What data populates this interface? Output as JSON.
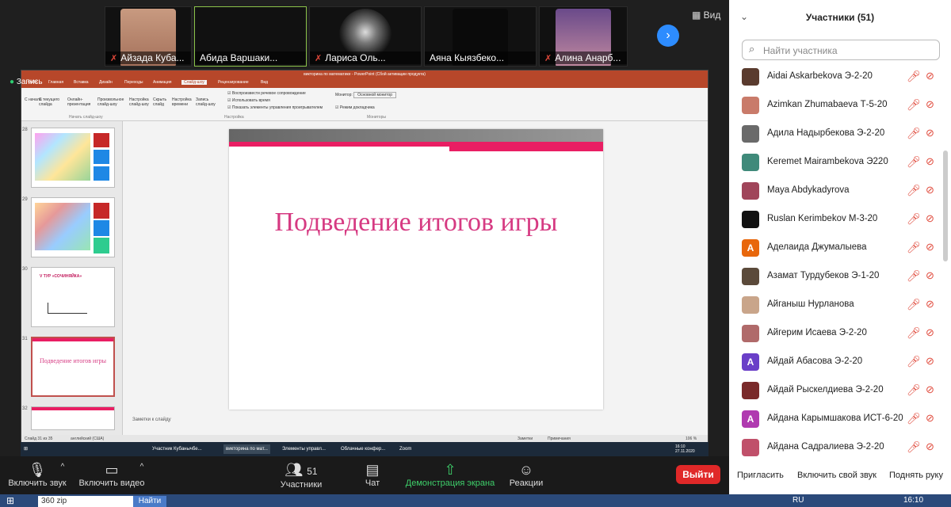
{
  "videos": [
    {
      "name": "Айзада Куба...",
      "muted": true
    },
    {
      "name": "Абида Варшаки...",
      "muted": false
    },
    {
      "name": "Лариса Оль...",
      "muted": true
    },
    {
      "name": "Аяна Кыязбеко...",
      "muted": false
    },
    {
      "name": "Алина Анарб...",
      "muted": true
    }
  ],
  "view_label": "Вид",
  "recording_label": "Запись",
  "ppt": {
    "title": "викторина по математике - PowerPoint (Сбой активации продукта)",
    "tabs": [
      "Файл",
      "Главная",
      "Вставка",
      "Дизайн",
      "Переходы",
      "Анимация",
      "Слайд-шоу",
      "Рецензирование",
      "Вид"
    ],
    "ribbon_groups": [
      "Начать слайд-шоу",
      "Настройка",
      "Мониторы"
    ],
    "ribbon_items": [
      "С начала",
      "С текущего слайда",
      "Онлайн-презентация",
      "Произвольное слайд-шоу",
      "Настройка слайд-шоу",
      "Скрыть слайд",
      "Настройка времени",
      "Запись слайд-шоу"
    ],
    "checks": [
      "Воспроизвести речевое сопровождение",
      "Использовать время",
      "Показать элементы управления проигрывателем"
    ],
    "monitor_label": "Монитор:",
    "monitor_value": "Основной монитор",
    "presenter_view": "Режим докладчика",
    "slide_numbers": [
      "28",
      "29",
      "30",
      "31",
      "32"
    ],
    "slide30_heading": "V ТУР «СОЧИНЯЙКА»",
    "slide31_text": "Подведение итогов игры",
    "main_slide_text": "Подведение итогов игры",
    "notes_placeholder": "Заметки к слайду",
    "status_left": "Слайд 31 из 35",
    "status_lang": "английский (США)",
    "status_notes": "Заметки",
    "status_comments": "Примечания",
    "zoom": "106 %",
    "clock_time": "16:10",
    "clock_date": "27.11.2020"
  },
  "share_taskbar": [
    "Участник Кубанычбе...",
    "викторина по мат...",
    "Элементы управл...",
    "Облачные конфер...",
    "Zoom"
  ],
  "controls": {
    "audio": "Включить звук",
    "video": "Включить видео",
    "participants": "Участники",
    "participants_count": "51",
    "chat": "Чат",
    "share": "Демонстрация экрана",
    "reactions": "Реакции",
    "end": "Выйти"
  },
  "os_taskbar": {
    "search_text": "360 zip",
    "search_button": "Найти",
    "lang": "RU",
    "time": "16:10"
  },
  "panel": {
    "title": "Участники (51)",
    "search_placeholder": "Найти участника",
    "participants": [
      {
        "name": "Aidai Askarbekova Э-2-20",
        "avatar": "photo",
        "color": "#5a3b2e"
      },
      {
        "name": "Azimkan Zhumabaeva Т-5-20",
        "avatar": "photo",
        "color": "#c97b6a"
      },
      {
        "name": "Адила Надырбекова Э-2-20",
        "avatar": "photo",
        "color": "#6a6a6a"
      },
      {
        "name": "Keremet Mairambekova Э220",
        "avatar": "photo",
        "color": "#3f8a7a"
      },
      {
        "name": "Maya Abdykadyrova",
        "avatar": "photo",
        "color": "#a0455a"
      },
      {
        "name": "Ruslan Kerimbekov М-3-20",
        "avatar": "photo",
        "color": "#111111"
      },
      {
        "name": "Аделаида Джумалыева",
        "avatar": "А",
        "color": "#e8670c"
      },
      {
        "name": "Азамат Турдубеков  Э-1-20",
        "avatar": "photo",
        "color": "#5b4a3a"
      },
      {
        "name": "Айганыш Нурланова",
        "avatar": "photo",
        "color": "#c9a58a"
      },
      {
        "name": "Айгерим Исаева Э-2-20",
        "avatar": "photo",
        "color": "#b06a6a"
      },
      {
        "name": "Айдай Абасова Э-2-20",
        "avatar": "A",
        "color": "#6a3fc8"
      },
      {
        "name": "Айдай Рыскелдиева Э-2-20",
        "avatar": "photo",
        "color": "#7a2a2a"
      },
      {
        "name": "Айдана Карымшакова ИСТ-6-20",
        "avatar": "A",
        "color": "#b03ab0"
      },
      {
        "name": "Айдана Садралиева Э-2-20",
        "avatar": "photo",
        "color": "#c0506a"
      }
    ],
    "buttons": [
      "Пригласить",
      "Включить свой звук",
      "Поднять руку"
    ]
  }
}
